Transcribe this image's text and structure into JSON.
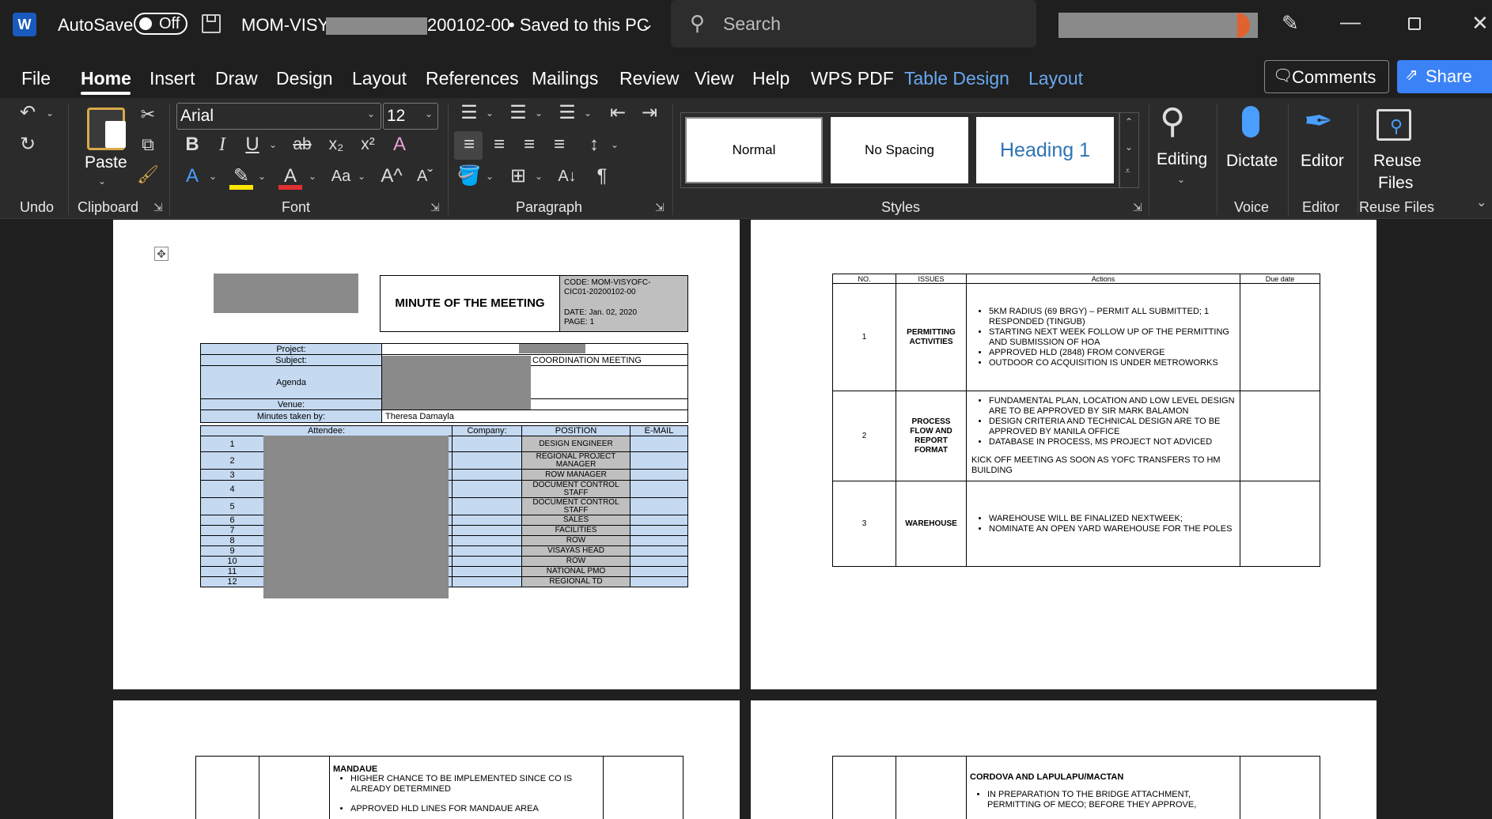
{
  "titlebar": {
    "app_icon": "word-icon",
    "autosave_label": "AutoSave",
    "autosave_state": "Off",
    "filename_prefix": "MOM-VISYO",
    "filename_suffix": "200102-00",
    "saved_status": "• Saved to this PC",
    "search_placeholder": "Search"
  },
  "tabs": [
    "File",
    "Home",
    "Insert",
    "Draw",
    "Design",
    "Layout",
    "References",
    "Mailings",
    "Review",
    "View",
    "Help",
    "WPS PDF",
    "Table Design",
    "Layout"
  ],
  "right_buttons": {
    "comments": "Comments",
    "share": "Share"
  },
  "ribbon": {
    "font_name": "Arial",
    "font_size": "12",
    "paste_label": "Paste",
    "styles": {
      "normal": "Normal",
      "no_spacing": "No Spacing",
      "heading1": "Heading 1"
    },
    "editing": "Editing",
    "dictate": "Dictate",
    "editor": "Editor",
    "reuse": "Reuse",
    "files": "Files",
    "groups": {
      "undo": "Undo",
      "clipboard": "Clipboard",
      "font": "Font",
      "paragraph": "Paragraph",
      "styles": "Styles",
      "voice": "Voice",
      "editor": "Editor",
      "reuse": "Reuse Files"
    }
  },
  "page1": {
    "header_title": "MINUTE OF THE MEETING",
    "code_line1": "CODE:  MOM-VISYOFC-",
    "code_line2": "CIC01-20200102-00",
    "date": "DATE: Jan. 02, 2020",
    "page": "PAGE: 1",
    "labels": {
      "project": "Project:",
      "subject": "Subject:",
      "agenda": "Agenda",
      "venue": "Venue:",
      "minutes": "Minutes taken by:",
      "attendee": "Attendee:",
      "company": "Company:",
      "position": "POSITION",
      "email": "E-MAIL"
    },
    "subject_value": "COORDINATION MEETING",
    "minutes_value": "Theresa Damayla",
    "attendees": [
      {
        "no": "1",
        "position": "DESIGN ENGINEER"
      },
      {
        "no": "2",
        "position": "REGIONAL PROJECT MANAGER"
      },
      {
        "no": "3",
        "position": "ROW MANAGER"
      },
      {
        "no": "4",
        "position": "DOCUMENT CONTROL STAFF"
      },
      {
        "no": "5",
        "position": "DOCUMENT CONTROL STAFF"
      },
      {
        "no": "6",
        "position": "SALES"
      },
      {
        "no": "7",
        "position": "FACILITIES"
      },
      {
        "no": "8",
        "position": "ROW"
      },
      {
        "no": "9",
        "position": "VISAYAS HEAD"
      },
      {
        "no": "10",
        "position": "ROW"
      },
      {
        "no": "11",
        "position": "NATIONAL PMO"
      },
      {
        "no": "12",
        "position": "REGIONAL TD"
      }
    ]
  },
  "page2": {
    "headers": {
      "no": "NO.",
      "issues": "ISSUES",
      "actions": "Actions",
      "due": "Due date"
    },
    "rows": [
      {
        "no": "1",
        "issue": "PERMITTING ACTIVITIES",
        "actions": [
          "5KM RADIUS (69 BRGY) – PERMIT ALL SUBMITTED; 1 RESPONDED (TINGUB)",
          "STARTING NEXT WEEK FOLLOW UP OF THE PERMITTING AND SUBMISSION OF HOA",
          "APPROVED HLD (2848) FROM CONVERGE",
          "OUTDOOR CO ACQUISITION IS UNDER METROWORKS"
        ],
        "note": ""
      },
      {
        "no": "2",
        "issue": "PROCESS FLOW AND REPORT FORMAT",
        "actions": [
          "FUNDAMENTAL PLAN, LOCATION AND LOW LEVEL DESIGN ARE TO BE APPROVED BY SIR MARK BALAMON",
          "DESIGN CRITERIA AND TECHNICAL DESIGN ARE TO BE APPROVED BY MANILA OFFICE",
          "DATABASE IN PROCESS, MS PROJECT NOT ADVICED"
        ],
        "note": "KICK OFF MEETING AS SOON AS YOFC TRANSFERS TO HM BUILDING"
      },
      {
        "no": "3",
        "issue": "WAREHOUSE",
        "actions": [
          "WAREHOUSE WILL BE FINALIZED NEXTWEEK;",
          "NOMINATE AN OPEN YARD WAREHOUSE FOR THE POLES"
        ],
        "note": ""
      }
    ]
  },
  "page3": {
    "heading": "MANDAUE",
    "items": [
      "HIGHER CHANCE TO BE IMPLEMENTED SINCE CO IS ALREADY DETERMINED",
      "APPROVED HLD LINES FOR MANDAUE AREA"
    ]
  },
  "page4": {
    "heading": "CORDOVA AND LAPULAPU/MACTAN",
    "items": [
      "IN PREPARATION TO THE BRIDGE ATTACHMENT, PERMITTING OF MECO; BEFORE THEY APPROVE,"
    ]
  },
  "colors": {
    "accent": "#4a9eff",
    "share_bg": "#3b82f6",
    "heading_blue": "#2e74b5",
    "cell_blue": "#c5d9f1",
    "cell_gray": "#bfbfbf"
  }
}
